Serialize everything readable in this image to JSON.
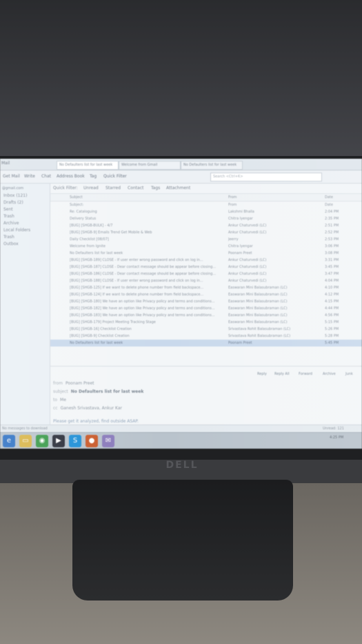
{
  "app": {
    "menu_label": "Mail",
    "tabs": [
      {
        "label": "No Defaulters list for last week"
      },
      {
        "label": "Welcome from Gmail"
      },
      {
        "label": "No Defaulters list for last week"
      }
    ]
  },
  "toolbar": {
    "get_mail": "Get Mail",
    "write": "Write",
    "chat": "Chat",
    "address_book": "Address Book",
    "tag": "Tag",
    "quick_filter": "Quick Filter",
    "search_placeholder": "Search <Ctrl+K>"
  },
  "sidebar": {
    "account": "@gmail.com",
    "folders": [
      {
        "label": "Inbox (121)"
      },
      {
        "label": "Drafts (2)"
      },
      {
        "label": "Sent"
      },
      {
        "label": "Trash"
      },
      {
        "label": "Archive"
      },
      {
        "label": "Local Folders"
      },
      {
        "label": "Trash"
      },
      {
        "label": "Outbox"
      }
    ]
  },
  "filter_bar": {
    "quick_filter": "Quick Filter:",
    "unread": "Unread",
    "starred": "Starred",
    "contact": "Contact",
    "tags": "Tags",
    "attachment": "Attachment"
  },
  "columns": {
    "subject": "Subject",
    "from": "From",
    "date": "Date"
  },
  "messages": [
    {
      "subject": "Subject:",
      "from": "From",
      "date": "Date"
    },
    {
      "subject": "Re: Cataloguing",
      "from": "Lakshmi Bhalla",
      "date": "2:04 PM"
    },
    {
      "subject": "Delivery Status",
      "from": "Chitra Iyengar",
      "date": "2:35 PM"
    },
    {
      "subject": "[BUG] [SHGB-BULK] - 4/7",
      "from": "Ankur Chaturvedi (LC)",
      "date": "2:51 PM"
    },
    {
      "subject": "[BUG] [SHGB-9] Emails Trend Get Mobile & Web",
      "from": "Ankur Chaturvedi (LC)",
      "date": "2:52 PM"
    },
    {
      "subject": "Daily Checklist [08/07]",
      "from": "Jeerry",
      "date": "2:53 PM"
    },
    {
      "subject": "Welcome from Ignite",
      "from": "Chitra Iyengar",
      "date": "3:06 PM"
    },
    {
      "subject": "No Defaulters list for last week",
      "from": "Poonam Preet",
      "date": "3:08 PM"
    },
    {
      "subject": "[BUG] [SHGB-189] CLOSE - If user enter wrong password and click on log in...",
      "from": "Ankur Chaturvedi (LC)",
      "date": "3:31 PM"
    },
    {
      "subject": "[BUG] [SHGB-187] CLOSE - Dear contact message should be appear before closing...",
      "from": "Ankur Chaturvedi (LC)",
      "date": "3:45 PM"
    },
    {
      "subject": "[BUG] [SHGB-186] CLOSE - Dear contact message should be appear before closing...",
      "from": "Ankur Chaturvedi (LC)",
      "date": "3:47 PM"
    },
    {
      "subject": "[BUG] [SHGB-188] CLOSE - If user enter wrong password and click on log in...",
      "from": "Ankur Chaturvedi (LC)",
      "date": "4:04 PM"
    },
    {
      "subject": "[BUG] [SHGB-125] If we want to delete phone number from field backspace...",
      "from": "Easwaran Mini Balasubraman (LC)",
      "date": "4:10 PM"
    },
    {
      "subject": "[BUG] [SHGB-124] If we want to delete phone number from field backspace...",
      "from": "Easwaran Mini Balasubraman (LC)",
      "date": "4:12 PM"
    },
    {
      "subject": "[BUG] [SHGB-180] We have an option like Privacy policy and terms and conditions...",
      "from": "Easwaran Mini Balasubraman (LC)",
      "date": "4:15 PM"
    },
    {
      "subject": "[BUG] [SHGB-182] We have an option like Privacy policy and terms and conditions...",
      "from": "Easwaran Mini Balasubraman (LC)",
      "date": "4:44 PM"
    },
    {
      "subject": "[BUG] [SHGB-183] We have an option like Privacy policy and terms and conditions...",
      "from": "Easwaran Mini Balasubraman (LC)",
      "date": "4:56 PM"
    },
    {
      "subject": "[BUG] [SHGB-179] Project Meeting Tracking Stage",
      "from": "Easwaran Mini Balasubraman (LC)",
      "date": "5:15 PM"
    },
    {
      "subject": "[BUG] [SHGB-16] Checklist Creation",
      "from": "Srivastava Rohit Balasubraman (LC)",
      "date": "5:26 PM"
    },
    {
      "subject": "[BUG] [SHGB-9] Checklist Creation",
      "from": "Srivastava Rohit Balasubraman (LC)",
      "date": "5:28 PM"
    },
    {
      "subject": "No Defaulters list for last week",
      "from": "Poonam Preet",
      "date": "5:45 PM"
    }
  ],
  "preview_actions": {
    "reply": "Reply",
    "reply_all": "Reply All",
    "forward": "Forward",
    "archive": "Archive",
    "junk": "Junk"
  },
  "preview": {
    "from_label": "from",
    "from_value": "Poonam Preet",
    "subject_label": "subject",
    "subject_value": "No Defaulters list for last week",
    "to_label": "to",
    "to_value": "Me",
    "cc_label": "cc",
    "cc_value": "Ganesh Srivastava, Ankur Kar",
    "body": "Please get it analyzed, find outside ASAP."
  },
  "status": {
    "left": "No messages to download",
    "right": "Unread: 121"
  },
  "taskbar": {
    "tray": "4:25 PM"
  },
  "monitor": {
    "brand": "DELL"
  }
}
